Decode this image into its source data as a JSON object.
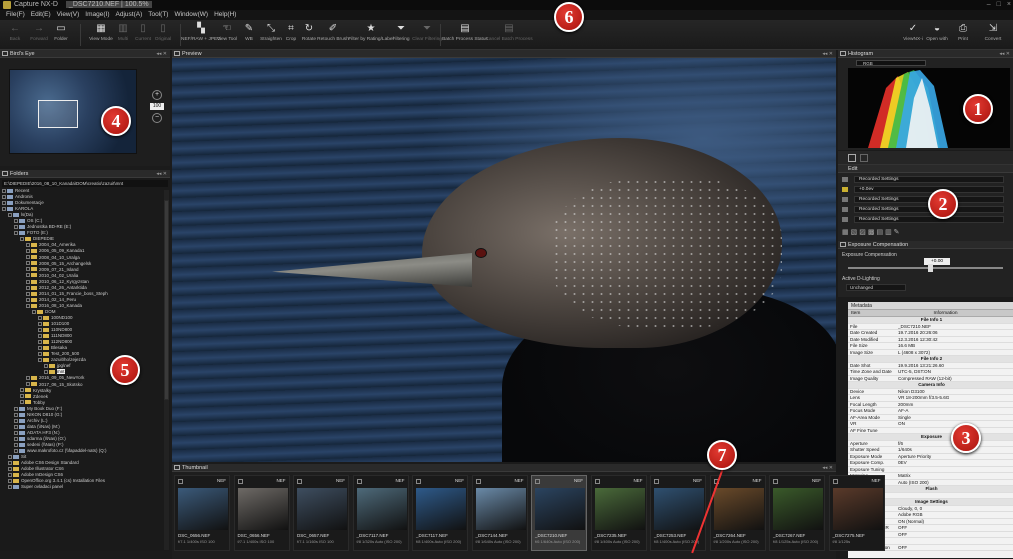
{
  "window": {
    "title": "Capture NX-D",
    "file_info": "_DSC7210.NEF | 100.5%",
    "controls": [
      "–",
      "□",
      "×"
    ]
  },
  "menu": [
    "File(F)",
    "Edit(E)",
    "View(V)",
    "Image(I)",
    "Adjust(A)",
    "Tool(T)",
    "Window(W)",
    "Help(H)"
  ],
  "toolbar": {
    "back": "Back",
    "forward": "Forward",
    "folder": "Folder",
    "view_mode": "View Mode",
    "multi": "Multi",
    "current": "Current",
    "original": "Original",
    "nef_jpeg": "NEF/RAW + JPEG",
    "view_tool": "View Tool",
    "wb": "WB",
    "straighten": "Straighten",
    "crop": "Crop",
    "rotate": "Rotate",
    "retouch": "Retouch Brush",
    "filter_rating": "Filter by Rating/Label",
    "filtering": "Filtering",
    "clear_filtering": "Clear Filtering",
    "batch_status": "Batch Process Status",
    "cancel_batch": "Cancel Batch Process",
    "viewnx": "ViewNX-i",
    "open_with": "Open with",
    "print": "Print",
    "convert": "Convert"
  },
  "panels": {
    "birds_eye": "Bird's Eye",
    "zoom_value": "100",
    "folders": "Folders",
    "folder_path": "E:\\DIEPEDIE\\2016_08_10_Kanada\\DOM\\creatio\\zazuit\\mnt",
    "preview": "Preview",
    "thumbnail": "Thumbnail",
    "histogram": "Histogram",
    "histogram_channel": "RGB",
    "edit": "Edit",
    "exposure_panel": "Exposure Compensation",
    "exposure_label": "Exposure Compensation",
    "exposure_value": "+0.00",
    "active_dlighting": "Active D-Lighting",
    "active_dlighting_value": "Unchanged",
    "metadata": "Metadata"
  },
  "edit_rows": [
    {
      "label": "Recorded Settings"
    },
    {
      "label": "+0.0ev"
    },
    {
      "label": "Recorded Settings"
    },
    {
      "label": "Recorded Settings"
    },
    {
      "label": "Recorded Settings"
    }
  ],
  "tree": [
    {
      "d": 0,
      "t": "Recent",
      "dr": true
    },
    {
      "d": 0,
      "t": "Andronis",
      "dr": true
    },
    {
      "d": 0,
      "t": "Dokumentacje",
      "dr": true
    },
    {
      "d": 0,
      "t": "KAROLA",
      "dr": true
    },
    {
      "d": 1,
      "t": "ls(Da)",
      "dr": true
    },
    {
      "d": 2,
      "t": "OS (C:)",
      "dr": true
    },
    {
      "d": 2,
      "t": "Jednostka BD-RE (E:)",
      "dr": true
    },
    {
      "d": 2,
      "t": "FOTO (E:)",
      "dr": true
    },
    {
      "d": 3,
      "t": "DIEPEDIE"
    },
    {
      "d": 4,
      "t": "2004_04_Amerika"
    },
    {
      "d": 4,
      "t": "2006_05_09_Kanada1"
    },
    {
      "d": 4,
      "t": "2008_04_10_Uralga"
    },
    {
      "d": 4,
      "t": "2008_05_15_Archangelsk"
    },
    {
      "d": 4,
      "t": "2009_07_21_Island"
    },
    {
      "d": 4,
      "t": "2010_04_02_Uralia"
    },
    {
      "d": 4,
      "t": "2010_06_12_Kyrgyzstan"
    },
    {
      "d": 4,
      "t": "2012_04_26_Antarktida"
    },
    {
      "d": 4,
      "t": "2014_01_15_Francie_boss_Steph"
    },
    {
      "d": 4,
      "t": "2014_02_14_Peru"
    },
    {
      "d": 4,
      "t": "2016_08_10_Kanada"
    },
    {
      "d": 5,
      "t": "DOM"
    },
    {
      "d": 6,
      "t": "100ND100"
    },
    {
      "d": 6,
      "t": "101D100"
    },
    {
      "d": 6,
      "t": "110ND800"
    },
    {
      "d": 6,
      "t": "111ND800"
    },
    {
      "d": 6,
      "t": "112ND800"
    },
    {
      "d": 6,
      "t": "Blesaka"
    },
    {
      "d": 6,
      "t": "Test_200_500"
    },
    {
      "d": 6,
      "t": "zazuit\\ho\\zejezda"
    },
    {
      "d": 7,
      "t": "jpg\\nef"
    },
    {
      "d": 7,
      "t": "mnt",
      "hl": true
    },
    {
      "d": 4,
      "t": "2016_09_05_NewYork"
    },
    {
      "d": 4,
      "t": "2017_06_15_Skotsko"
    },
    {
      "d": 3,
      "t": "Krystalky"
    },
    {
      "d": 3,
      "t": "Zdenek"
    },
    {
      "d": 3,
      "t": "Tobby"
    },
    {
      "d": 2,
      "t": "My Book Duo (F:)",
      "dr": true
    },
    {
      "d": 2,
      "t": "NIKON D810 (G:)",
      "dr": true
    },
    {
      "d": 2,
      "t": "Archiv (L:)",
      "dr": true
    },
    {
      "d": 2,
      "t": "data (\\\\Nas) (M:)",
      "dr": true
    },
    {
      "d": 2,
      "t": "ADATA HF3 (N:)",
      "dr": true
    },
    {
      "d": 2,
      "t": "sdarma (\\\\Nas) (O:)",
      "dr": true
    },
    {
      "d": 2,
      "t": "sedeni (\\\\Nas) (P:)",
      "dr": true
    },
    {
      "d": 2,
      "t": "www.makrofoto.cz (\\\\fapaddel-nats) (Q:)",
      "dr": true
    },
    {
      "d": 1,
      "t": "Sit",
      "dr": true
    },
    {
      "d": 1,
      "t": "Adobe CS6 Design Standard"
    },
    {
      "d": 1,
      "t": "Adobe Illustrator CS6"
    },
    {
      "d": 1,
      "t": "Adobe InDesign CS6"
    },
    {
      "d": 1,
      "t": "OpenOffice.org 3.4.1 (cs) Installation Files"
    },
    {
      "d": 1,
      "t": "Super ovladaci panel",
      "dr": true
    }
  ],
  "meta_cols": [
    "Item",
    "Information"
  ],
  "meta_rows": [
    {
      "s": "File Info 1"
    },
    {
      "k": "File",
      "v": "_DSC7210.NEF"
    },
    {
      "k": "Date Created",
      "v": "19.7.2016 20:26:06"
    },
    {
      "k": "Date Modified",
      "v": "12.3.2016 12:30:42"
    },
    {
      "k": "File Size",
      "v": "16.6 MB"
    },
    {
      "k": "Image Size",
      "v": "L (4608 x 3072)"
    },
    {
      "s": "File Info 2"
    },
    {
      "k": "Date Shot",
      "v": "19.9.2016 13:21:26.60"
    },
    {
      "k": "Time Zone and Date",
      "v": "UTC-5, DST:ON"
    },
    {
      "k": "Image Quality",
      "v": "Compressed RAW (12-bit)"
    },
    {
      "s": "Camera Info"
    },
    {
      "k": "Device",
      "v": "Nikon D3100"
    },
    {
      "k": "Lens",
      "v": "VR 18-200mm f/3.5-5.6G"
    },
    {
      "k": "Focal Length",
      "v": "200mm"
    },
    {
      "k": "Focus Mode",
      "v": "AF-A"
    },
    {
      "k": "AF-Area Mode",
      "v": "Single"
    },
    {
      "k": "VR",
      "v": "ON"
    },
    {
      "k": "AF Fine Tune",
      "v": ""
    },
    {
      "s": "Exposure"
    },
    {
      "k": "Aperture",
      "v": "f/6"
    },
    {
      "k": "Shutter Speed",
      "v": "1/640s"
    },
    {
      "k": "Exposure Mode",
      "v": "Aperture Priority"
    },
    {
      "k": "Exposure Comp.",
      "v": "0EV"
    },
    {
      "k": "Exposure Tuning",
      "v": ""
    },
    {
      "k": "Metering",
      "v": "Matrix"
    },
    {
      "k": "ISO Sensitivity",
      "v": "Auto (ISO 200)"
    },
    {
      "s": "Flash"
    },
    {
      "k": "Device",
      "v": ""
    },
    {
      "s": "Image Settings"
    },
    {
      "k": "White Balance",
      "v": "Cloudy, 0, 0"
    },
    {
      "k": "Color Space",
      "v": "Adobe RGB"
    },
    {
      "k": "High ISO NR",
      "v": "ON (Normal)"
    },
    {
      "k": "Long Exposure NR",
      "v": "OFF"
    },
    {
      "k": "Active D-Lighting",
      "v": "OFF"
    },
    {
      "k": "Vignette Control",
      "v": ""
    },
    {
      "k": "Auto Distortion Con",
      "v": "OFF"
    }
  ],
  "thumbnails": [
    {
      "name": "DSC_0656.NEF",
      "info": "f/7.1 1/400s ISO 100",
      "bg": "#3b5a7a"
    },
    {
      "name": "DSC_0656.NEF",
      "info": "f/7.1 1/400s ISO 100",
      "bg": "#6e6a66"
    },
    {
      "name": "DSC_0657.NEF",
      "info": "f/7.1 1/160s ISO 100",
      "bg": "#3e4e60"
    },
    {
      "name": "_DSC7117.NEF",
      "info": "f/8 1/320s Auto (ISO 200)",
      "bg": "#4e6a7a"
    },
    {
      "name": "_DSC7117.NEF",
      "info": "f/8 1/400s Auto (ISO 200)",
      "bg": "#2e5a8a"
    },
    {
      "name": "_DSC7144.NEF",
      "info": "f/8 1/640s Auto (ISO 200)",
      "bg": "#6a8aa8"
    },
    {
      "name": "_DSC7210.NEF",
      "info": "f/6 1/640s Auto (ISO 200)",
      "bg": "#2b4460",
      "sel": true
    },
    {
      "name": "_DSC7235.NEF",
      "info": "f/8 1/400s Auto (ISO 200)",
      "bg": "#4a6a3a"
    },
    {
      "name": "_DSC7253.NEF",
      "info": "f/8 1/400s Auto (ISO 200)",
      "bg": "#2f5070"
    },
    {
      "name": "_DSC7264.NEF",
      "info": "f/8 1/200s Auto (ISO 200)",
      "bg": "#6a4a2a"
    },
    {
      "name": "_DSC7267.NEF",
      "info": "f/8 1/125s Auto (ISO 200)",
      "bg": "#3a5a2a"
    },
    {
      "name": "_DSC7275.NEF",
      "info": "f/8 1/125s",
      "bg": "#5a3a2a"
    }
  ],
  "badges": [
    "1",
    "2",
    "3",
    "4",
    "5",
    "6",
    "7"
  ]
}
